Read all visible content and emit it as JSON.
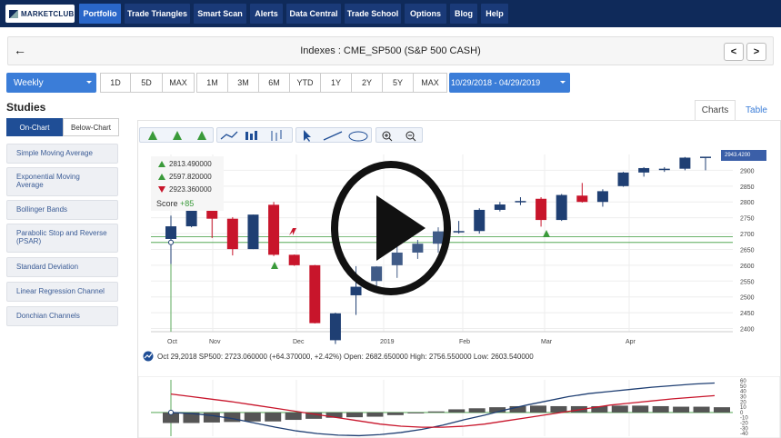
{
  "nav": {
    "logo": "MARKETCLUB",
    "items": [
      "Portfolio",
      "Trade Triangles",
      "Smart Scan",
      "Alerts",
      "Data Central",
      "Trade School",
      "Options",
      "Blog",
      "Help"
    ],
    "active": "Portfolio"
  },
  "header": {
    "title": "Indexes : CME_SP500 (S&P 500 CASH)",
    "back": "←",
    "prev": "<",
    "next": ">"
  },
  "timeframe": {
    "period": "Weekly",
    "short_ranges": [
      "1D",
      "5D",
      "MAX"
    ],
    "long_ranges": [
      "1M",
      "3M",
      "6M",
      "YTD",
      "1Y",
      "2Y",
      "5Y",
      "MAX"
    ],
    "date_range": "10/29/2018 - 04/29/2019"
  },
  "studies": {
    "title": "Studies",
    "tabs": [
      "On-Chart",
      "Below-Chart"
    ],
    "items": [
      "Simple Moving Average",
      "Exponential Moving Average",
      "Bollinger Bands",
      "Parabolic Stop and Reverse (PSAR)",
      "Standard Deviation",
      "Linear Regression Channel",
      "Donchian Channels"
    ]
  },
  "view_tabs": [
    "Charts",
    "Table"
  ],
  "legend": {
    "t1": "2813.490000",
    "t2": "2597.820000",
    "t3": "2923.360000",
    "score_label": "Score",
    "score_value": "+85"
  },
  "price_tag": "2943.4200",
  "info_line": "Oct 29,2018 SP500: 2723.060000 (+64.370000, +2.42%) Open: 2682.650000 High: 2756.550000 Low: 2603.540000",
  "colors": {
    "up": "#1f3f73",
    "down": "#c8152b",
    "nav": "#0f2a5a",
    "accent": "#3b7dd8",
    "ma_green": "#3a9a3a"
  },
  "chart_data": {
    "type": "candlestick",
    "x_ticks": [
      "Oct",
      "Nov",
      "Dec",
      "2019",
      "Feb",
      "Mar",
      "Apr"
    ],
    "y_ticks": [
      2900,
      2850,
      2800,
      2750,
      2700,
      2650,
      2600,
      2550,
      2500,
      2450,
      2400
    ],
    "ylim": [
      2390,
      2950
    ],
    "candles": [
      {
        "o": 2683,
        "c": 2723,
        "h": 2757,
        "l": 2604
      },
      {
        "o": 2723,
        "c": 2781,
        "h": 2816,
        "l": 2720
      },
      {
        "o": 2781,
        "c": 2747,
        "h": 2782,
        "l": 2686
      },
      {
        "o": 2747,
        "c": 2651,
        "h": 2752,
        "l": 2631
      },
      {
        "o": 2651,
        "c": 2760,
        "h": 2760,
        "l": 2651
      },
      {
        "o": 2791,
        "c": 2633,
        "h": 2800,
        "l": 2629
      },
      {
        "o": 2633,
        "c": 2600,
        "h": 2634,
        "l": 2598
      },
      {
        "o": 2600,
        "c": 2417,
        "h": 2601,
        "l": 2416
      },
      {
        "o": 2363,
        "c": 2448,
        "h": 2450,
        "l": 2351
      },
      {
        "o": 2505,
        "c": 2532,
        "h": 2597,
        "l": 2443
      },
      {
        "o": 2550,
        "c": 2596,
        "h": 2597,
        "l": 2532
      },
      {
        "o": 2600,
        "c": 2640,
        "h": 2660,
        "l": 2560
      },
      {
        "o": 2640,
        "c": 2668,
        "h": 2680,
        "l": 2620
      },
      {
        "o": 2668,
        "c": 2707,
        "h": 2720,
        "l": 2640
      },
      {
        "o": 2707,
        "c": 2708,
        "h": 2740,
        "l": 2700
      },
      {
        "o": 2708,
        "c": 2775,
        "h": 2780,
        "l": 2700
      },
      {
        "o": 2775,
        "c": 2792,
        "h": 2800,
        "l": 2770
      },
      {
        "o": 2800,
        "c": 2803,
        "h": 2815,
        "l": 2790
      },
      {
        "o": 2810,
        "c": 2743,
        "h": 2815,
        "l": 2722
      },
      {
        "o": 2743,
        "c": 2822,
        "h": 2825,
        "l": 2740
      },
      {
        "o": 2820,
        "c": 2800,
        "h": 2860,
        "l": 2798
      },
      {
        "o": 2800,
        "c": 2834,
        "h": 2840,
        "l": 2785
      },
      {
        "o": 2850,
        "c": 2893,
        "h": 2895,
        "l": 2848
      },
      {
        "o": 2893,
        "c": 2907,
        "h": 2910,
        "l": 2880
      },
      {
        "o": 2905,
        "c": 2905,
        "h": 2910,
        "l": 2895
      },
      {
        "o": 2905,
        "c": 2940,
        "h": 2942,
        "l": 2900
      },
      {
        "o": 2940,
        "c": 2943,
        "h": 2943,
        "l": 2900
      }
    ],
    "lower_y_ticks": [
      60,
      50,
      40,
      30,
      20,
      10,
      0,
      -10,
      -20,
      -30,
      -40
    ],
    "histogram": [
      -20,
      -20,
      -19,
      -18,
      -17,
      -17,
      -14,
      -12,
      -10,
      -9,
      -8,
      -5,
      -1,
      2,
      6,
      8,
      10,
      12,
      13,
      12,
      12,
      12,
      13,
      13,
      12,
      11,
      11,
      10
    ],
    "line_blue": [
      0,
      -2,
      -6,
      -12,
      -20,
      -28,
      -35,
      -40,
      -43,
      -44,
      -42,
      -38,
      -32,
      -24,
      -14,
      -5,
      5,
      14,
      22,
      30,
      36,
      40,
      44,
      48,
      51,
      54,
      56
    ],
    "line_red": [
      35,
      30,
      25,
      20,
      14,
      8,
      2,
      -4,
      -10,
      -16,
      -22,
      -26,
      -28,
      -28,
      -26,
      -22,
      -16,
      -10,
      -4,
      2,
      8,
      14,
      18,
      22,
      26,
      29,
      32
    ]
  }
}
